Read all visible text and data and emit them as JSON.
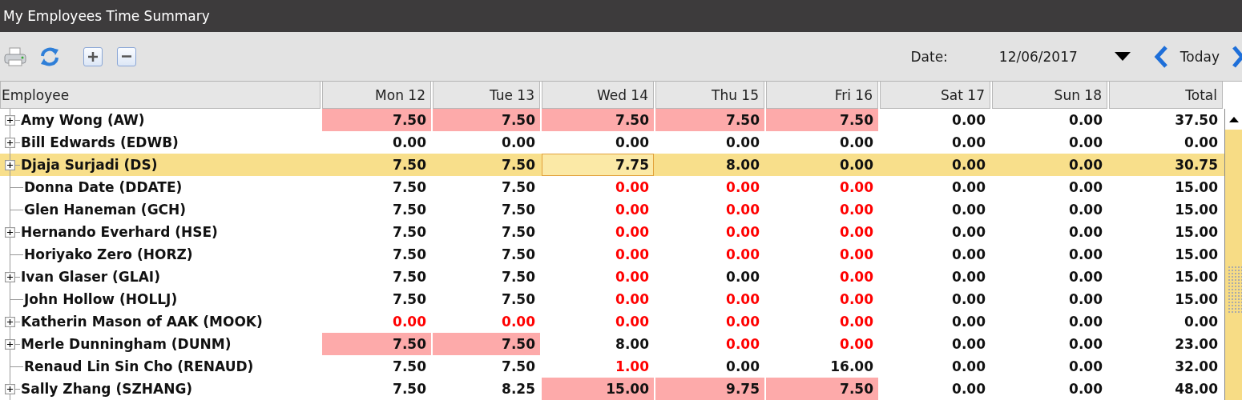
{
  "window": {
    "title": "My Employees Time Summary"
  },
  "toolbar": {
    "date_label": "Date:",
    "date_value": "12/06/2017",
    "today_button": "Today"
  },
  "table": {
    "columns": [
      "Employee",
      "Mon 12",
      "Tue 13",
      "Wed 14",
      "Thu 15",
      "Fri 16",
      "Sat 17",
      "Sun 18",
      "Total"
    ],
    "rows": [
      {
        "has_children": true,
        "selected": false,
        "cells": [
          {
            "value": "Amy Wong (AW)",
            "highlighted": false,
            "warning": false,
            "focused": false
          },
          {
            "value": "7.50",
            "highlighted": true,
            "warning": false,
            "focused": false
          },
          {
            "value": "7.50",
            "highlighted": true,
            "warning": false,
            "focused": false
          },
          {
            "value": "7.50",
            "highlighted": true,
            "warning": false,
            "focused": false
          },
          {
            "value": "7.50",
            "highlighted": true,
            "warning": false,
            "focused": false
          },
          {
            "value": "7.50",
            "highlighted": true,
            "warning": false,
            "focused": false
          },
          {
            "value": "0.00",
            "highlighted": false,
            "warning": false,
            "focused": false
          },
          {
            "value": "0.00",
            "highlighted": false,
            "warning": false,
            "focused": false
          },
          {
            "value": "37.50",
            "highlighted": false,
            "warning": false,
            "focused": false
          }
        ]
      },
      {
        "has_children": true,
        "selected": false,
        "cells": [
          {
            "value": "Bill Edwards (EDWB)",
            "highlighted": false,
            "warning": false,
            "focused": false
          },
          {
            "value": "0.00",
            "highlighted": false,
            "warning": false,
            "focused": false
          },
          {
            "value": "0.00",
            "highlighted": false,
            "warning": false,
            "focused": false
          },
          {
            "value": "0.00",
            "highlighted": false,
            "warning": false,
            "focused": false
          },
          {
            "value": "0.00",
            "highlighted": false,
            "warning": false,
            "focused": false
          },
          {
            "value": "0.00",
            "highlighted": false,
            "warning": false,
            "focused": false
          },
          {
            "value": "0.00",
            "highlighted": false,
            "warning": false,
            "focused": false
          },
          {
            "value": "0.00",
            "highlighted": false,
            "warning": false,
            "focused": false
          },
          {
            "value": "0.00",
            "highlighted": false,
            "warning": false,
            "focused": false
          }
        ]
      },
      {
        "has_children": true,
        "selected": true,
        "cells": [
          {
            "value": "Djaja Surjadi (DS)",
            "highlighted": false,
            "warning": false,
            "focused": false
          },
          {
            "value": "7.50",
            "highlighted": false,
            "warning": false,
            "focused": false
          },
          {
            "value": "7.50",
            "highlighted": false,
            "warning": false,
            "focused": false
          },
          {
            "value": "7.75",
            "highlighted": false,
            "warning": false,
            "focused": true
          },
          {
            "value": "8.00",
            "highlighted": false,
            "warning": false,
            "focused": false
          },
          {
            "value": "0.00",
            "highlighted": false,
            "warning": false,
            "focused": false
          },
          {
            "value": "0.00",
            "highlighted": false,
            "warning": false,
            "focused": false
          },
          {
            "value": "0.00",
            "highlighted": false,
            "warning": false,
            "focused": false
          },
          {
            "value": "30.75",
            "highlighted": false,
            "warning": false,
            "focused": false
          }
        ]
      },
      {
        "has_children": false,
        "selected": false,
        "cells": [
          {
            "value": "Donna Date (DDATE)",
            "highlighted": false,
            "warning": false,
            "focused": false
          },
          {
            "value": "7.50",
            "highlighted": false,
            "warning": false,
            "focused": false
          },
          {
            "value": "7.50",
            "highlighted": false,
            "warning": false,
            "focused": false
          },
          {
            "value": "0.00",
            "highlighted": false,
            "warning": true,
            "focused": false
          },
          {
            "value": "0.00",
            "highlighted": false,
            "warning": true,
            "focused": false
          },
          {
            "value": "0.00",
            "highlighted": false,
            "warning": true,
            "focused": false
          },
          {
            "value": "0.00",
            "highlighted": false,
            "warning": false,
            "focused": false
          },
          {
            "value": "0.00",
            "highlighted": false,
            "warning": false,
            "focused": false
          },
          {
            "value": "15.00",
            "highlighted": false,
            "warning": false,
            "focused": false
          }
        ]
      },
      {
        "has_children": false,
        "selected": false,
        "cells": [
          {
            "value": "Glen Haneman (GCH)",
            "highlighted": false,
            "warning": false,
            "focused": false
          },
          {
            "value": "7.50",
            "highlighted": false,
            "warning": false,
            "focused": false
          },
          {
            "value": "7.50",
            "highlighted": false,
            "warning": false,
            "focused": false
          },
          {
            "value": "0.00",
            "highlighted": false,
            "warning": true,
            "focused": false
          },
          {
            "value": "0.00",
            "highlighted": false,
            "warning": true,
            "focused": false
          },
          {
            "value": "0.00",
            "highlighted": false,
            "warning": true,
            "focused": false
          },
          {
            "value": "0.00",
            "highlighted": false,
            "warning": false,
            "focused": false
          },
          {
            "value": "0.00",
            "highlighted": false,
            "warning": false,
            "focused": false
          },
          {
            "value": "15.00",
            "highlighted": false,
            "warning": false,
            "focused": false
          }
        ]
      },
      {
        "has_children": true,
        "selected": false,
        "cells": [
          {
            "value": "Hernando Everhard (HSE)",
            "highlighted": false,
            "warning": false,
            "focused": false
          },
          {
            "value": "7.50",
            "highlighted": false,
            "warning": false,
            "focused": false
          },
          {
            "value": "7.50",
            "highlighted": false,
            "warning": false,
            "focused": false
          },
          {
            "value": "0.00",
            "highlighted": false,
            "warning": true,
            "focused": false
          },
          {
            "value": "0.00",
            "highlighted": false,
            "warning": true,
            "focused": false
          },
          {
            "value": "0.00",
            "highlighted": false,
            "warning": true,
            "focused": false
          },
          {
            "value": "0.00",
            "highlighted": false,
            "warning": false,
            "focused": false
          },
          {
            "value": "0.00",
            "highlighted": false,
            "warning": false,
            "focused": false
          },
          {
            "value": "15.00",
            "highlighted": false,
            "warning": false,
            "focused": false
          }
        ]
      },
      {
        "has_children": false,
        "selected": false,
        "cells": [
          {
            "value": "Horiyako Zero (HORZ)",
            "highlighted": false,
            "warning": false,
            "focused": false
          },
          {
            "value": "7.50",
            "highlighted": false,
            "warning": false,
            "focused": false
          },
          {
            "value": "7.50",
            "highlighted": false,
            "warning": false,
            "focused": false
          },
          {
            "value": "0.00",
            "highlighted": false,
            "warning": true,
            "focused": false
          },
          {
            "value": "0.00",
            "highlighted": false,
            "warning": true,
            "focused": false
          },
          {
            "value": "0.00",
            "highlighted": false,
            "warning": true,
            "focused": false
          },
          {
            "value": "0.00",
            "highlighted": false,
            "warning": false,
            "focused": false
          },
          {
            "value": "0.00",
            "highlighted": false,
            "warning": false,
            "focused": false
          },
          {
            "value": "15.00",
            "highlighted": false,
            "warning": false,
            "focused": false
          }
        ]
      },
      {
        "has_children": true,
        "selected": false,
        "cells": [
          {
            "value": "Ivan Glaser (GLAI)",
            "highlighted": false,
            "warning": false,
            "focused": false
          },
          {
            "value": "7.50",
            "highlighted": false,
            "warning": false,
            "focused": false
          },
          {
            "value": "7.50",
            "highlighted": false,
            "warning": false,
            "focused": false
          },
          {
            "value": "0.00",
            "highlighted": false,
            "warning": true,
            "focused": false
          },
          {
            "value": "0.00",
            "highlighted": false,
            "warning": false,
            "focused": false
          },
          {
            "value": "0.00",
            "highlighted": false,
            "warning": true,
            "focused": false
          },
          {
            "value": "0.00",
            "highlighted": false,
            "warning": false,
            "focused": false
          },
          {
            "value": "0.00",
            "highlighted": false,
            "warning": false,
            "focused": false
          },
          {
            "value": "15.00",
            "highlighted": false,
            "warning": false,
            "focused": false
          }
        ]
      },
      {
        "has_children": false,
        "selected": false,
        "cells": [
          {
            "value": "John Hollow (HOLLJ)",
            "highlighted": false,
            "warning": false,
            "focused": false
          },
          {
            "value": "7.50",
            "highlighted": false,
            "warning": false,
            "focused": false
          },
          {
            "value": "7.50",
            "highlighted": false,
            "warning": false,
            "focused": false
          },
          {
            "value": "0.00",
            "highlighted": false,
            "warning": true,
            "focused": false
          },
          {
            "value": "0.00",
            "highlighted": false,
            "warning": true,
            "focused": false
          },
          {
            "value": "0.00",
            "highlighted": false,
            "warning": true,
            "focused": false
          },
          {
            "value": "0.00",
            "highlighted": false,
            "warning": false,
            "focused": false
          },
          {
            "value": "0.00",
            "highlighted": false,
            "warning": false,
            "focused": false
          },
          {
            "value": "15.00",
            "highlighted": false,
            "warning": false,
            "focused": false
          }
        ]
      },
      {
        "has_children": true,
        "selected": false,
        "cells": [
          {
            "value": "Katherin Mason of AAK (MOOK)",
            "highlighted": false,
            "warning": false,
            "focused": false
          },
          {
            "value": "0.00",
            "highlighted": false,
            "warning": true,
            "focused": false
          },
          {
            "value": "0.00",
            "highlighted": false,
            "warning": true,
            "focused": false
          },
          {
            "value": "0.00",
            "highlighted": false,
            "warning": true,
            "focused": false
          },
          {
            "value": "0.00",
            "highlighted": false,
            "warning": true,
            "focused": false
          },
          {
            "value": "0.00",
            "highlighted": false,
            "warning": true,
            "focused": false
          },
          {
            "value": "0.00",
            "highlighted": false,
            "warning": false,
            "focused": false
          },
          {
            "value": "0.00",
            "highlighted": false,
            "warning": false,
            "focused": false
          },
          {
            "value": "0.00",
            "highlighted": false,
            "warning": false,
            "focused": false
          }
        ]
      },
      {
        "has_children": true,
        "selected": false,
        "cells": [
          {
            "value": "Merle Dunningham (DUNM)",
            "highlighted": false,
            "warning": false,
            "focused": false
          },
          {
            "value": "7.50",
            "highlighted": true,
            "warning": false,
            "focused": false
          },
          {
            "value": "7.50",
            "highlighted": true,
            "warning": false,
            "focused": false
          },
          {
            "value": "8.00",
            "highlighted": false,
            "warning": false,
            "focused": false
          },
          {
            "value": "0.00",
            "highlighted": false,
            "warning": true,
            "focused": false
          },
          {
            "value": "0.00",
            "highlighted": false,
            "warning": true,
            "focused": false
          },
          {
            "value": "0.00",
            "highlighted": false,
            "warning": false,
            "focused": false
          },
          {
            "value": "0.00",
            "highlighted": false,
            "warning": false,
            "focused": false
          },
          {
            "value": "23.00",
            "highlighted": false,
            "warning": false,
            "focused": false
          }
        ]
      },
      {
        "has_children": false,
        "selected": false,
        "cells": [
          {
            "value": "Renaud Lin Sin Cho (RENAUD)",
            "highlighted": false,
            "warning": false,
            "focused": false
          },
          {
            "value": "7.50",
            "highlighted": false,
            "warning": false,
            "focused": false
          },
          {
            "value": "7.50",
            "highlighted": false,
            "warning": false,
            "focused": false
          },
          {
            "value": "1.00",
            "highlighted": false,
            "warning": true,
            "focused": false
          },
          {
            "value": "0.00",
            "highlighted": false,
            "warning": false,
            "focused": false
          },
          {
            "value": "16.00",
            "highlighted": false,
            "warning": false,
            "focused": false
          },
          {
            "value": "0.00",
            "highlighted": false,
            "warning": false,
            "focused": false
          },
          {
            "value": "0.00",
            "highlighted": false,
            "warning": false,
            "focused": false
          },
          {
            "value": "32.00",
            "highlighted": false,
            "warning": false,
            "focused": false
          }
        ]
      },
      {
        "has_children": true,
        "selected": false,
        "cells": [
          {
            "value": "Sally Zhang (SZHANG)",
            "highlighted": false,
            "warning": false,
            "focused": false
          },
          {
            "value": "7.50",
            "highlighted": false,
            "warning": false,
            "focused": false
          },
          {
            "value": "8.25",
            "highlighted": false,
            "warning": false,
            "focused": false
          },
          {
            "value": "15.00",
            "highlighted": true,
            "warning": false,
            "focused": false
          },
          {
            "value": "9.75",
            "highlighted": true,
            "warning": false,
            "focused": false
          },
          {
            "value": "7.50",
            "highlighted": true,
            "warning": false,
            "focused": false
          },
          {
            "value": "0.00",
            "highlighted": false,
            "warning": false,
            "focused": false
          },
          {
            "value": "0.00",
            "highlighted": false,
            "warning": false,
            "focused": false
          },
          {
            "value": "48.00",
            "highlighted": false,
            "warning": false,
            "focused": false
          }
        ]
      }
    ]
  }
}
